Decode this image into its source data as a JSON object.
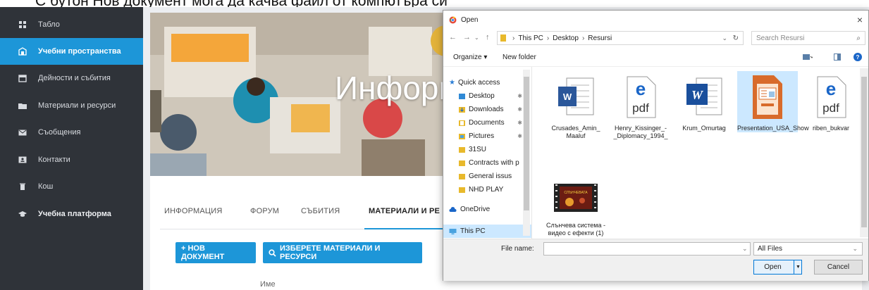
{
  "caption": "С бутон Нов документ мога да качва файл от компютъра си",
  "sidebar": {
    "items": [
      {
        "label": "Табло",
        "icon": "grid-icon"
      },
      {
        "label": "Учебни пространства",
        "icon": "building-icon",
        "active": true
      },
      {
        "label": "Дейности и събития",
        "icon": "calendar-icon"
      },
      {
        "label": "Материали и ресурси",
        "icon": "folder-icon"
      },
      {
        "label": "Съобщения",
        "icon": "envelope-icon"
      },
      {
        "label": "Контакти",
        "icon": "contact-card-icon"
      },
      {
        "label": "Кош",
        "icon": "trash-icon"
      },
      {
        "label": "Учебна платформа",
        "icon": "graduation-cap-icon"
      }
    ],
    "background": "#2f3339",
    "accent": "#1d96d8"
  },
  "main": {
    "banner_title": "Информ",
    "tabs": [
      "ИНФОРМАЦИЯ",
      "ФОРУМ",
      "СЪБИТИЯ",
      "МАТЕРИАЛИ И РЕ"
    ],
    "active_tab": 3,
    "new_doc_label": "+ НОВ ДОКУМЕНТ",
    "choose_label": "ИЗБЕРЕТЕ МАТЕРИАЛИ И РЕСУРСИ",
    "column_name": "Име"
  },
  "dialog": {
    "title": "Open",
    "close": "×",
    "path": [
      "This PC",
      "Desktop",
      "Resursi"
    ],
    "search_placeholder": "Search Resursi",
    "organize": "Organize ▾",
    "new_folder": "New folder",
    "nav": [
      {
        "label": "Quick access",
        "icon": "star-icon",
        "head": true
      },
      {
        "label": "Desktop",
        "icon": "desktop-folder-icon",
        "pin": true
      },
      {
        "label": "Downloads",
        "icon": "downloads-folder-icon",
        "pin": true
      },
      {
        "label": "Documents",
        "icon": "documents-folder-icon",
        "pin": true
      },
      {
        "label": "Pictures",
        "icon": "pictures-folder-icon",
        "pin": true
      },
      {
        "label": "31SU",
        "icon": "folder-icon"
      },
      {
        "label": "Contracts with p",
        "icon": "folder-icon"
      },
      {
        "label": "General issus",
        "icon": "folder-icon"
      },
      {
        "label": "NHD PLAY",
        "icon": "folder-icon"
      },
      {
        "label": "OneDrive",
        "icon": "cloud-icon",
        "head": true
      },
      {
        "label": "This PC",
        "icon": "computer-icon",
        "head": true,
        "selected": true
      }
    ],
    "files": [
      {
        "name": "Crusades_Amin_ Maaluf",
        "icon": "word-doc-icon"
      },
      {
        "name": "Henry_Kissinger_-_Diplomacy_1994_",
        "icon": "edge-pdf-icon"
      },
      {
        "name": "Krum_Omurtag",
        "icon": "word-doc-icon"
      },
      {
        "name": "Presentation_USA_Show",
        "icon": "impress-presentation-icon",
        "selected": true
      },
      {
        "name": "riben_bukvar",
        "icon": "edge-pdf-icon"
      },
      {
        "name": "Слънчева система - видео с ефекти (1)",
        "icon": "video-thumbnail-icon"
      }
    ],
    "file_name_label": "File name:",
    "file_name_value": "",
    "file_type": "All Files",
    "open_label": "Open",
    "cancel_label": "Cancel"
  }
}
